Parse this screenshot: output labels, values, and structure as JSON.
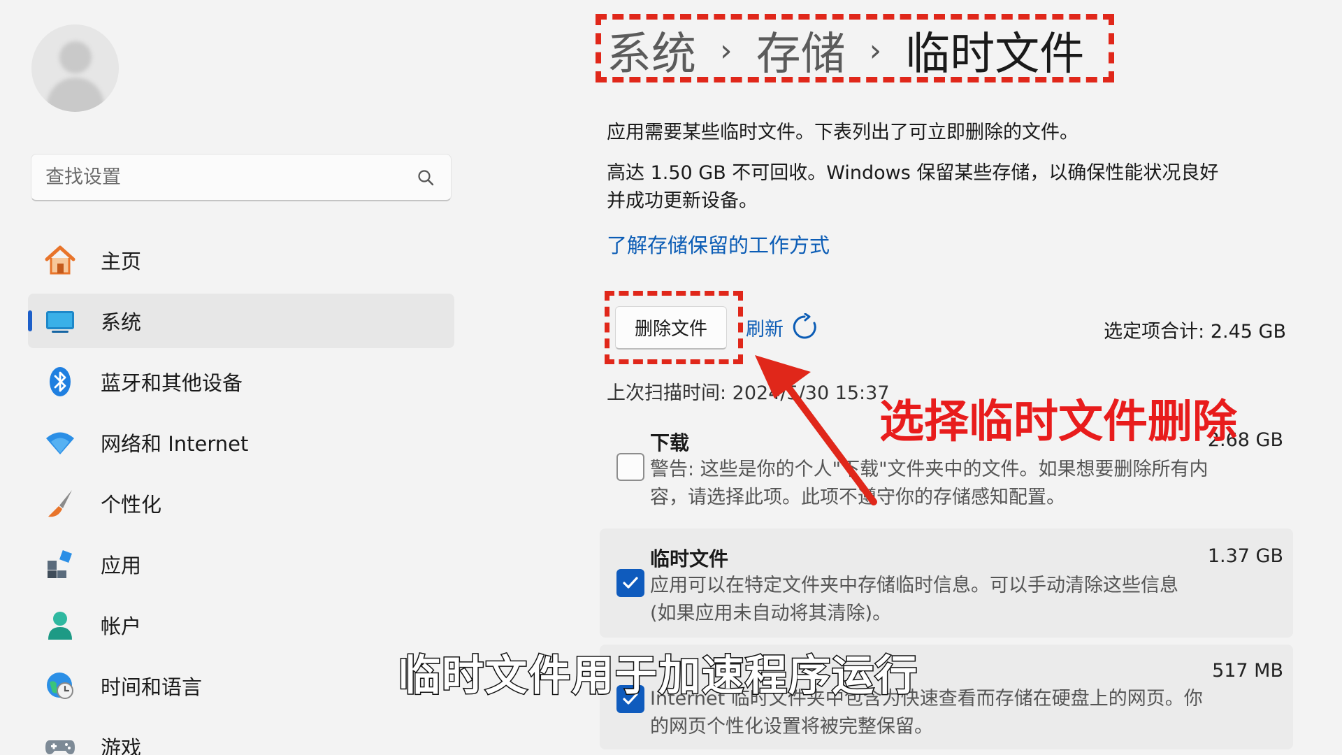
{
  "sidebar": {
    "user": {
      "name": "",
      "email": ""
    },
    "search": {
      "placeholder": "查找设置"
    },
    "items": [
      {
        "label": "主页",
        "icon": "home-icon"
      },
      {
        "label": "系统",
        "icon": "system-display-icon",
        "active": true
      },
      {
        "label": "蓝牙和其他设备",
        "icon": "bluetooth-icon"
      },
      {
        "label": "网络和 Internet",
        "icon": "wifi-icon"
      },
      {
        "label": "个性化",
        "icon": "paintbrush-icon"
      },
      {
        "label": "应用",
        "icon": "apps-icon"
      },
      {
        "label": "帐户",
        "icon": "account-icon"
      },
      {
        "label": "时间和语言",
        "icon": "globe-clock-icon"
      },
      {
        "label": "游戏",
        "icon": "gamepad-icon"
      }
    ]
  },
  "main": {
    "breadcrumb": [
      "系统",
      "存储",
      "临时文件"
    ],
    "intro": "应用需要某些临时文件。下表列出了可立即删除的文件。",
    "reserved_line1": "高达 1.50 GB 不可回收。Windows 保留某些存储，以确保性能状况良好",
    "reserved_line2": "并成功更新设备。",
    "learn_link": "了解存储保留的工作方式",
    "delete_button": "删除文件",
    "refresh_label": "刷新",
    "selected_total": "选定项合计: 2.45 GB",
    "last_scan": "上次扫描时间: 2024/5/30 15:37",
    "items": [
      {
        "title": "下载",
        "size": "2.68 GB",
        "checked": false,
        "desc_line1": "警告: 这些是你的个人\"下载\"文件夹中的文件。如果想要删除所有内",
        "desc_line2": "容，请选择此项。此项不遵守你的存储感知配置。"
      },
      {
        "title": "临时文件",
        "size": "1.37 GB",
        "checked": true,
        "desc_line1": "应用可以在特定文件夹中存储临时信息。可以手动清除这些信息",
        "desc_line2": "(如果应用未自动将其清除)。"
      },
      {
        "title": "",
        "size": "517 MB",
        "checked": true,
        "desc_line1": "Internet 临时文件夹中包含为快速查看而存储在硬盘上的网页。你",
        "desc_line2": "的网页个性化设置将被完整保留。"
      }
    ]
  },
  "overlay": {
    "annotation": "选择临时文件删除",
    "subtitle": "临时文件用于加速程序运行",
    "annotation_color": "#e0271a"
  }
}
